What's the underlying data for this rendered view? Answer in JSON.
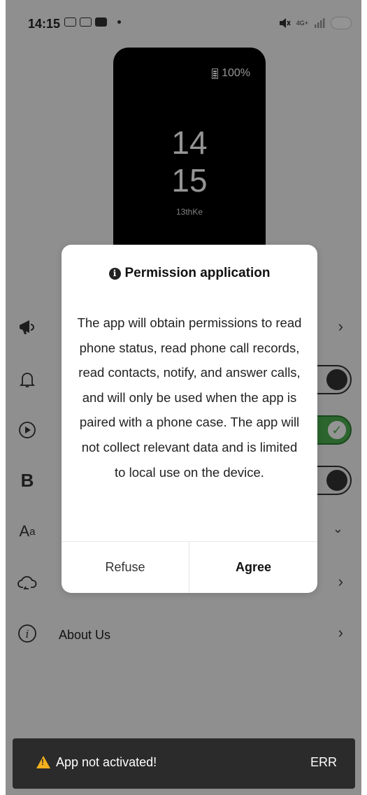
{
  "status_bar": {
    "time": "14:15",
    "network": "4G+"
  },
  "watch_preview": {
    "battery": "100%",
    "hour": "14",
    "minute": "15",
    "label": "13thKe"
  },
  "settings": {
    "items": [
      {
        "icon": "megaphone-icon",
        "control": "chevron"
      },
      {
        "icon": "bell-icon",
        "control": "toggle",
        "on": false
      },
      {
        "icon": "play-circle-icon",
        "control": "toggle",
        "on": true
      },
      {
        "icon": "bold-b-icon",
        "control": "toggle",
        "on": false
      },
      {
        "icon": "font-size-icon",
        "control": "chevron-down"
      },
      {
        "icon": "cloud-sync-icon",
        "control": "chevron"
      },
      {
        "icon": "info-circle-icon",
        "label": "About Us",
        "control": "chevron"
      }
    ]
  },
  "dialog": {
    "title": "Permission application",
    "body": "The app will obtain permissions to read phone status, read phone call records, read contacts, notify, and answer calls, and will only be used when the app is paired with a phone case. The app will not collect relevant data and is limited to local use on the device.",
    "refuse_label": "Refuse",
    "agree_label": "Agree"
  },
  "snackbar": {
    "message": "App not activated!",
    "action": "ERR",
    "warning_color": "#f2b01e"
  },
  "colors": {
    "toggle_on": "#4caf50",
    "overlay": "rgba(0,0,0,0.42)"
  }
}
